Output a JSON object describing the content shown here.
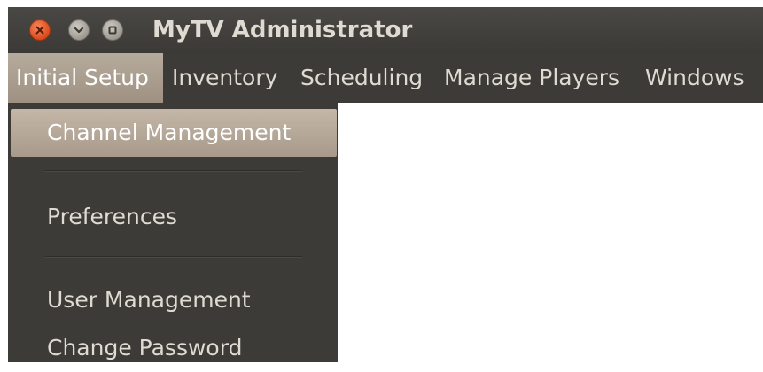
{
  "window": {
    "title": "MyTV Administrator",
    "controls": [
      {
        "name": "close-button",
        "icon": "close-icon"
      },
      {
        "name": "minimize-button",
        "icon": "minimize-icon"
      },
      {
        "name": "maximize-button",
        "icon": "maximize-icon"
      }
    ]
  },
  "menubar": {
    "items": [
      {
        "label": "Initial Setup",
        "active": true
      },
      {
        "label": "Inventory",
        "active": false
      },
      {
        "label": "Scheduling",
        "active": false
      },
      {
        "label": "Manage Players",
        "active": false
      },
      {
        "label": "Windows",
        "active": false
      }
    ]
  },
  "dropdown": {
    "items": [
      {
        "label": "Channel Management",
        "highlighted": true
      },
      {
        "label": "Preferences",
        "highlighted": false
      },
      {
        "label": "User Management",
        "highlighted": false
      },
      {
        "label": "Change Password",
        "highlighted": false
      }
    ]
  },
  "colors": {
    "titlebar": "#3a3935",
    "menubar": "#3c3b37",
    "text": "#dfdbd2",
    "highlight": "#b0a292",
    "close_button": "#e05a2b"
  }
}
